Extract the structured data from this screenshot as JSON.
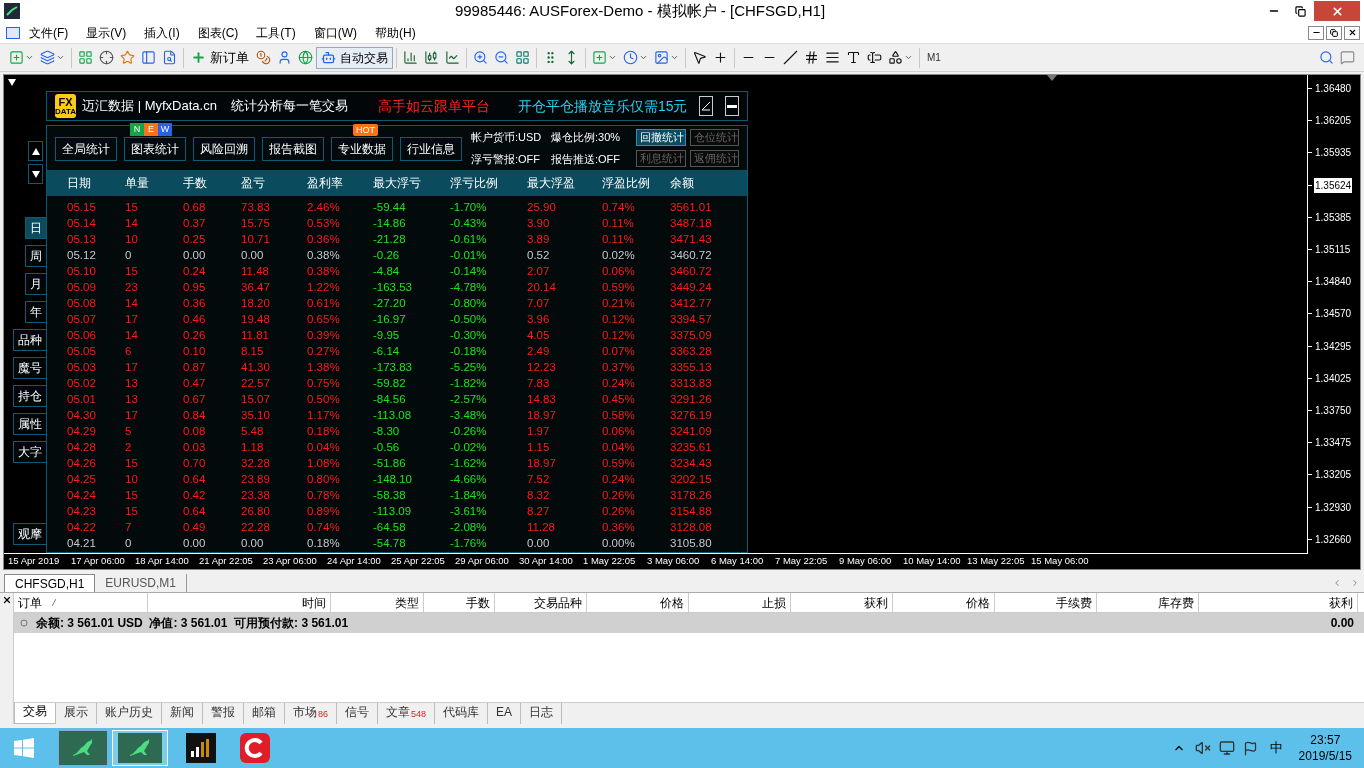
{
  "window": {
    "title": "99985446: AUSForex-Demo - 模拟帐户 - [CHFSGD,H1]"
  },
  "menu": [
    "文件(F)",
    "显示(V)",
    "插入(I)",
    "图表(C)",
    "工具(T)",
    "窗口(W)",
    "帮助(H)"
  ],
  "toolbar": {
    "new_order": "新订单",
    "auto_trading": "自动交易",
    "timeframe": "M1"
  },
  "panel": {
    "logo": {
      "top": "FX",
      "bottom": "DATA"
    },
    "brand": "迈汇数据 | MyfxData.cn",
    "slogan": "统计分析每一笔交易",
    "promo_red": "高手如云跟单平台",
    "promo_cyan": "开仓平仓播放音乐仅需15元",
    "side_buttons": [
      {
        "label": "日",
        "selected": true
      },
      {
        "label": "周",
        "selected": false
      },
      {
        "label": "月",
        "selected": false
      },
      {
        "label": "年",
        "selected": false
      },
      {
        "label": "品种",
        "selected": false
      },
      {
        "label": "魔号",
        "selected": false
      },
      {
        "label": "持仓",
        "selected": false
      },
      {
        "label": "属性",
        "selected": false
      },
      {
        "label": "大字",
        "selected": false
      }
    ],
    "side_bottom": "观摩",
    "buttons": [
      {
        "label": "全局统计"
      },
      {
        "label": "图表统计",
        "badges": [
          "N",
          "E",
          "W"
        ]
      },
      {
        "label": "风险回溯"
      },
      {
        "label": "报告截图"
      },
      {
        "label": "专业数据",
        "hot": "HOT"
      },
      {
        "label": "行业信息"
      }
    ],
    "info": [
      "帐户货币:USD",
      "爆仓比例:30%",
      "浮亏警报:OFF",
      "报告推送:OFF"
    ],
    "stat_buttons": [
      {
        "label": "回撤统计",
        "selected": true
      },
      {
        "label": "仓位统计",
        "selected": false
      },
      {
        "label": "利息统计",
        "selected": false
      },
      {
        "label": "返佣统计",
        "selected": false
      }
    ],
    "columns": [
      {
        "label": "日期",
        "kind": "normal"
      },
      {
        "label": "单量",
        "kind": "normal"
      },
      {
        "label": "手数",
        "kind": "normal"
      },
      {
        "label": "盈亏",
        "kind": "normal"
      },
      {
        "label": "盈利率",
        "kind": "normal"
      },
      {
        "label": "最大浮亏",
        "kind": "loss"
      },
      {
        "label": "浮亏比例",
        "kind": "loss"
      },
      {
        "label": "最大浮盈",
        "kind": "normal"
      },
      {
        "label": "浮盈比例",
        "kind": "normal"
      },
      {
        "label": "余额",
        "kind": "normal"
      }
    ],
    "rows": [
      {
        "kind": "active",
        "cells": [
          "05.15",
          "15",
          "0.68",
          "73.83",
          "2.46%",
          "-59.44",
          "-1.70%",
          "25.90",
          "0.74%",
          "3561.01"
        ]
      },
      {
        "kind": "active",
        "cells": [
          "05.14",
          "14",
          "0.37",
          "15.75",
          "0.53%",
          "-14.86",
          "-0.43%",
          "3.90",
          "0.11%",
          "3487.18"
        ]
      },
      {
        "kind": "active",
        "cells": [
          "05.13",
          "10",
          "0.25",
          "10.71",
          "0.36%",
          "-21.28",
          "-0.61%",
          "3.89",
          "0.11%",
          "3471.43"
        ]
      },
      {
        "kind": "flat",
        "cells": [
          "05.12",
          "0",
          "0.00",
          "0.00",
          "0.38%",
          "-0.26",
          "-0.01%",
          "0.52",
          "0.02%",
          "3460.72"
        ]
      },
      {
        "kind": "active",
        "cells": [
          "05.10",
          "15",
          "0.24",
          "11.48",
          "0.38%",
          "-4.84",
          "-0.14%",
          "2.07",
          "0.06%",
          "3460.72"
        ]
      },
      {
        "kind": "active",
        "cells": [
          "05.09",
          "23",
          "0.95",
          "36.47",
          "1.22%",
          "-163.53",
          "-4.78%",
          "20.14",
          "0.59%",
          "3449.24"
        ]
      },
      {
        "kind": "active",
        "cells": [
          "05.08",
          "14",
          "0.36",
          "18.20",
          "0.61%",
          "-27.20",
          "-0.80%",
          "7.07",
          "0.21%",
          "3412.77"
        ]
      },
      {
        "kind": "active",
        "cells": [
          "05.07",
          "17",
          "0.46",
          "19.48",
          "0.65%",
          "-16.97",
          "-0.50%",
          "3.96",
          "0.12%",
          "3394.57"
        ]
      },
      {
        "kind": "active",
        "cells": [
          "05.06",
          "14",
          "0.26",
          "11.81",
          "0.39%",
          "-9.95",
          "-0.30%",
          "4.05",
          "0.12%",
          "3375.09"
        ]
      },
      {
        "kind": "active",
        "cells": [
          "05.05",
          "6",
          "0.10",
          "8.15",
          "0.27%",
          "-6.14",
          "-0.18%",
          "2.49",
          "0.07%",
          "3363.28"
        ]
      },
      {
        "kind": "active",
        "cells": [
          "05.03",
          "17",
          "0.87",
          "41.30",
          "1.38%",
          "-173.83",
          "-5.25%",
          "12.23",
          "0.37%",
          "3355.13"
        ]
      },
      {
        "kind": "active",
        "cells": [
          "05.02",
          "13",
          "0.47",
          "22.57",
          "0.75%",
          "-59.82",
          "-1.82%",
          "7.83",
          "0.24%",
          "3313.83"
        ]
      },
      {
        "kind": "active",
        "cells": [
          "05.01",
          "13",
          "0.67",
          "15.07",
          "0.50%",
          "-84.56",
          "-2.57%",
          "14.83",
          "0.45%",
          "3291.26"
        ]
      },
      {
        "kind": "active",
        "cells": [
          "04.30",
          "17",
          "0.84",
          "35.10",
          "1.17%",
          "-113.08",
          "-3.48%",
          "18.97",
          "0.58%",
          "3276.19"
        ]
      },
      {
        "kind": "active",
        "cells": [
          "04.29",
          "5",
          "0.08",
          "5.48",
          "0.18%",
          "-8.30",
          "-0.26%",
          "1.97",
          "0.06%",
          "3241.09"
        ]
      },
      {
        "kind": "active",
        "cells": [
          "04.28",
          "2",
          "0.03",
          "1.18",
          "0.04%",
          "-0.56",
          "-0.02%",
          "1.15",
          "0.04%",
          "3235.61"
        ]
      },
      {
        "kind": "active",
        "cells": [
          "04.26",
          "15",
          "0.70",
          "32.28",
          "1.08%",
          "-51.86",
          "-1.62%",
          "18.97",
          "0.59%",
          "3234.43"
        ]
      },
      {
        "kind": "active",
        "cells": [
          "04.25",
          "10",
          "0.64",
          "23.89",
          "0.80%",
          "-148.10",
          "-4.66%",
          "7.52",
          "0.24%",
          "3202.15"
        ]
      },
      {
        "kind": "active",
        "cells": [
          "04.24",
          "15",
          "0.42",
          "23.38",
          "0.78%",
          "-58.38",
          "-1.84%",
          "8.32",
          "0.26%",
          "3178.26"
        ]
      },
      {
        "kind": "active",
        "cells": [
          "04.23",
          "15",
          "0.64",
          "26.80",
          "0.89%",
          "-113.09",
          "-3.61%",
          "8.27",
          "0.26%",
          "3154.88"
        ]
      },
      {
        "kind": "active",
        "cells": [
          "04.22",
          "7",
          "0.49",
          "22.28",
          "0.74%",
          "-64.58",
          "-2.08%",
          "11.28",
          "0.36%",
          "3128.08"
        ]
      },
      {
        "kind": "flat",
        "cells": [
          "04.21",
          "0",
          "0.00",
          "0.00",
          "0.18%",
          "-54.78",
          "-1.76%",
          "0.00",
          "0.00%",
          "3105.80"
        ]
      }
    ]
  },
  "price_axis": {
    "labels": [
      {
        "text": "1.36480",
        "current": false
      },
      {
        "text": "1.36205",
        "current": false
      },
      {
        "text": "1.35935",
        "current": false
      },
      {
        "text": "1.35624",
        "current": true
      },
      {
        "text": "1.35385",
        "current": false
      },
      {
        "text": "1.35115",
        "current": false
      },
      {
        "text": "1.34840",
        "current": false
      },
      {
        "text": "1.34570",
        "current": false
      },
      {
        "text": "1.34295",
        "current": false
      },
      {
        "text": "1.34025",
        "current": false
      },
      {
        "text": "1.33750",
        "current": false
      },
      {
        "text": "1.33475",
        "current": false
      },
      {
        "text": "1.33205",
        "current": false
      },
      {
        "text": "1.32930",
        "current": false
      },
      {
        "text": "1.32660",
        "current": false
      }
    ]
  },
  "time_axis": [
    "15 Apr 2019",
    "17 Apr 06:00",
    "18 Apr 14:00",
    "21 Apr 22:05",
    "23 Apr 06:00",
    "24 Apr 14:00",
    "25 Apr 22:05",
    "29 Apr 06:00",
    "30 Apr 14:00",
    "1 May 22:05",
    "3 May 06:00",
    "6 May 14:00",
    "7 May 22:05",
    "9 May 06:00",
    "10 May 14:00",
    "13 May 22:05",
    "15 May 06:00"
  ],
  "chart_tabs": [
    {
      "label": "CHFSGD,H1",
      "selected": true
    },
    {
      "label": "EURUSD,M1",
      "selected": false
    }
  ],
  "terminal": {
    "columns": [
      "订单",
      "时间",
      "类型",
      "手数",
      "交易品种",
      "价格",
      "止损",
      "获利",
      "价格",
      "手续费",
      "库存费",
      "获利"
    ],
    "summary": "余额: 3 561.01 USD  净值: 3 561.01  可用预付款: 3 561.01",
    "summary_profit": "0.00",
    "tabs": [
      {
        "label": "交易",
        "selected": true
      },
      {
        "label": "展示",
        "selected": false
      },
      {
        "label": "账户历史",
        "selected": false
      },
      {
        "label": "新闻",
        "selected": false
      },
      {
        "label": "警报",
        "selected": false
      },
      {
        "label": "邮箱",
        "selected": false
      },
      {
        "label": "市场",
        "count": "86",
        "selected": false
      },
      {
        "label": "信号",
        "selected": false
      },
      {
        "label": "文章",
        "count": "548",
        "selected": false
      },
      {
        "label": "代码库",
        "selected": false
      },
      {
        "label": "EA",
        "selected": false
      },
      {
        "label": "日志",
        "selected": false
      }
    ]
  },
  "taskbar": {
    "ime": "中",
    "time": "23:57",
    "date": "2019/5/15"
  }
}
